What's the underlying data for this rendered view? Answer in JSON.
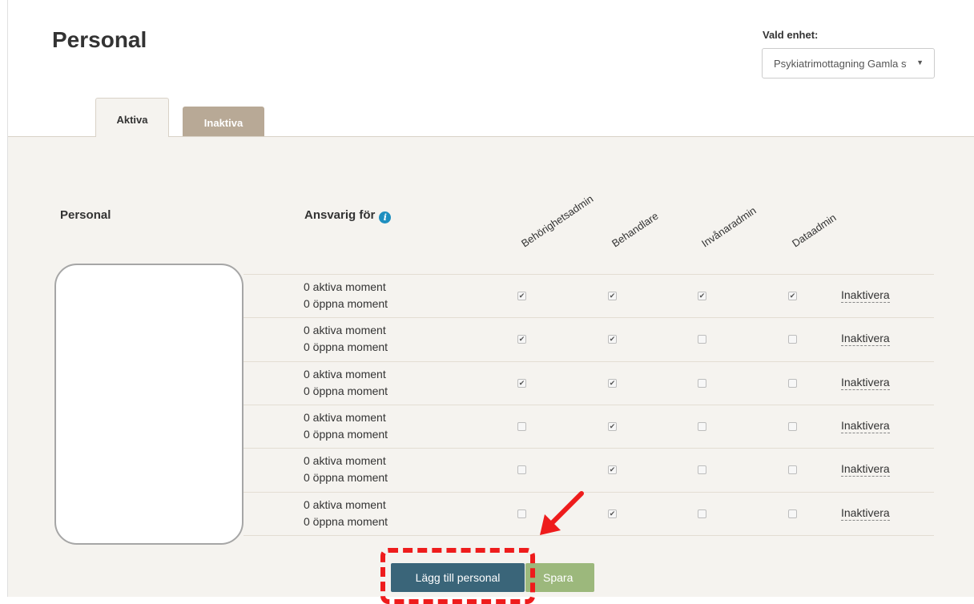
{
  "page": {
    "title": "Personal"
  },
  "unit": {
    "label": "Vald enhet:",
    "selected": "Psykiatrimottagning Gamla stan",
    "caret": "▼"
  },
  "tabs": [
    {
      "label": "Aktiva",
      "active": true
    },
    {
      "label": "Inaktiva",
      "active": false
    }
  ],
  "table": {
    "headers": {
      "personal": "Personal",
      "ansvarig": "Ansvarig för",
      "roles": [
        "Behörighetsadmin",
        "Behandlare",
        "Invånaradmin",
        "Dataadmin"
      ]
    },
    "info_icon": "i",
    "rows": [
      {
        "active": "0 aktiva moment",
        "open": "0 öppna moment",
        "roles": [
          true,
          true,
          true,
          true
        ],
        "action": "Inaktivera"
      },
      {
        "active": "0 aktiva moment",
        "open": "0 öppna moment",
        "roles": [
          true,
          true,
          false,
          false
        ],
        "action": "Inaktivera"
      },
      {
        "active": "0 aktiva moment",
        "open": "0 öppna moment",
        "roles": [
          true,
          true,
          false,
          false
        ],
        "action": "Inaktivera"
      },
      {
        "active": "0 aktiva moment",
        "open": "0 öppna moment",
        "roles": [
          false,
          true,
          false,
          false
        ],
        "action": "Inaktivera"
      },
      {
        "active": "0 aktiva moment",
        "open": "0 öppna moment",
        "roles": [
          false,
          true,
          false,
          false
        ],
        "action": "Inaktivera"
      },
      {
        "active": "0 aktiva moment",
        "open": "0 öppna moment",
        "roles": [
          false,
          true,
          false,
          false
        ],
        "action": "Inaktivera"
      }
    ]
  },
  "buttons": {
    "add": "Lägg till personal",
    "save": "Spara"
  },
  "icons": {
    "info": "info-icon",
    "arrow": "red-arrow-icon",
    "check": "✔"
  },
  "colors": {
    "panel": "#f5f3ef",
    "inactive_tab": "#b8a996",
    "add_button": "#3a6579",
    "save_button": "#9cb87c",
    "info": "#1f8fbf",
    "annotation": "#ee1c1c"
  }
}
